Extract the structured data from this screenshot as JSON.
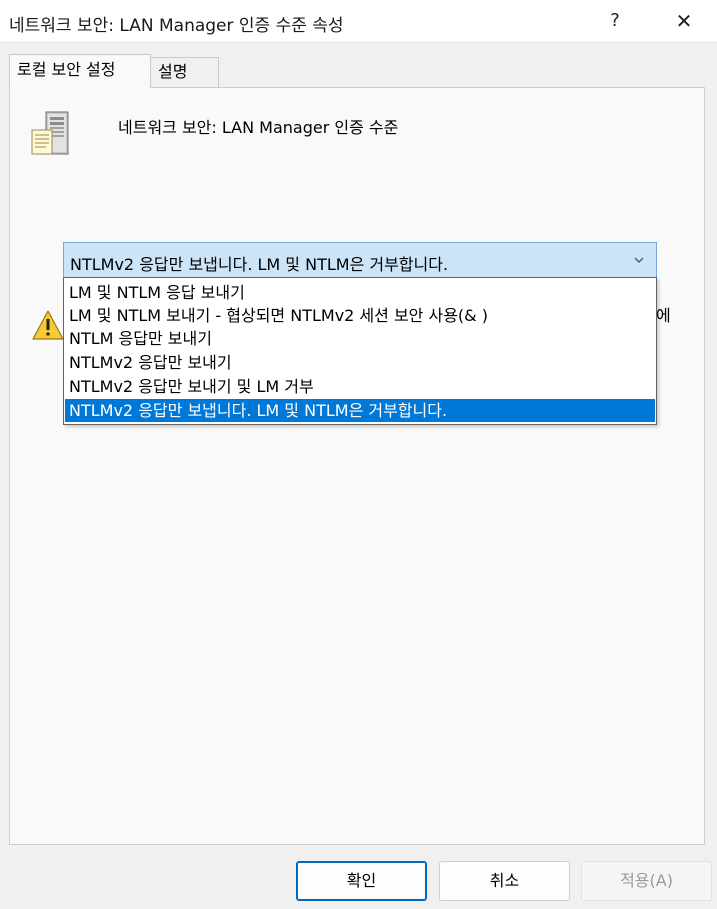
{
  "window": {
    "title": "네트워크 보안: LAN Manager 인증 수준 속성",
    "help_label": "?",
    "close_label": "✕"
  },
  "tabs": [
    {
      "label": "로컬 보안 설정",
      "active": true
    },
    {
      "label": "설명",
      "active": false
    }
  ],
  "policy": {
    "title": "네트워크 보안: LAN Manager 인증 수준",
    "icon": "server-icon"
  },
  "select": {
    "value": "NTLMv2 응답만 보냅니다. LM 및 NTLM은 거부합니다.",
    "options": [
      "LM 및 NTLM 응답 보내기",
      "LM 및 NTLM 보내기 - 협상되면 NTLMv2 세션 보안 사용(& )",
      "NTLM 응답만 보내기",
      "NTLMv2 응답만 보내기",
      "NTLMv2 응답만 보내기 및 LM 거부",
      "NTLMv2 응답만 보냅니다. LM 및 NTLM은 거부합니다."
    ],
    "selected_index": 5
  },
  "warning": {
    "icon": "warning-icon",
    "visible_text_tail": "에"
  },
  "buttons": {
    "ok": "확인",
    "cancel": "취소",
    "apply": "적용(A)"
  },
  "colors": {
    "selection": "#0078d7",
    "select_bg": "#cce4f7",
    "select_border": "#7aa5d6",
    "ok_border": "#0067c0"
  }
}
